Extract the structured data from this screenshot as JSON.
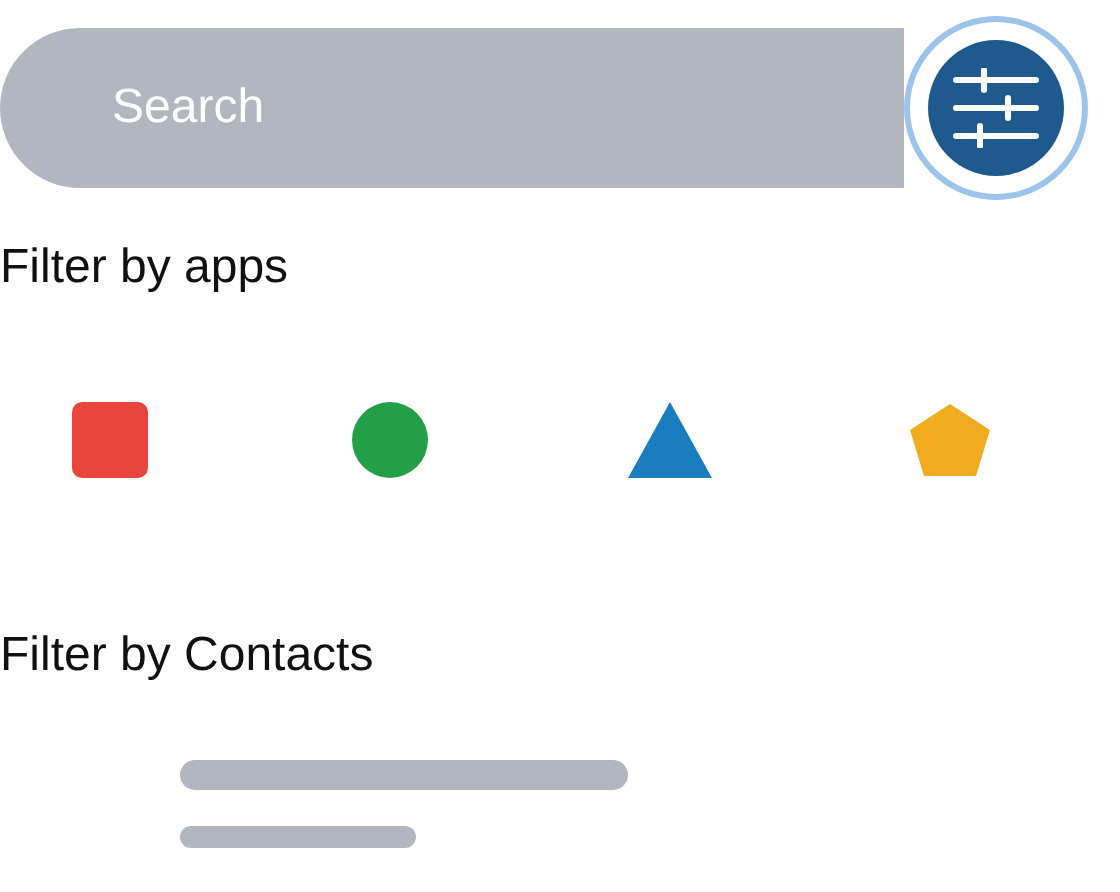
{
  "search": {
    "placeholder": "Search"
  },
  "filter_button": {
    "focused": true
  },
  "apps_section": {
    "heading": "Filter by apps",
    "apps": [
      {
        "kind": "square",
        "color": "#e8453c"
      },
      {
        "kind": "circle",
        "color": "#23a047"
      },
      {
        "kind": "triangle",
        "color": "#1a7dbf"
      },
      {
        "kind": "pentagon",
        "color": "#f0ab1f"
      }
    ]
  },
  "contacts_section": {
    "heading": "Filter by Contacts"
  }
}
